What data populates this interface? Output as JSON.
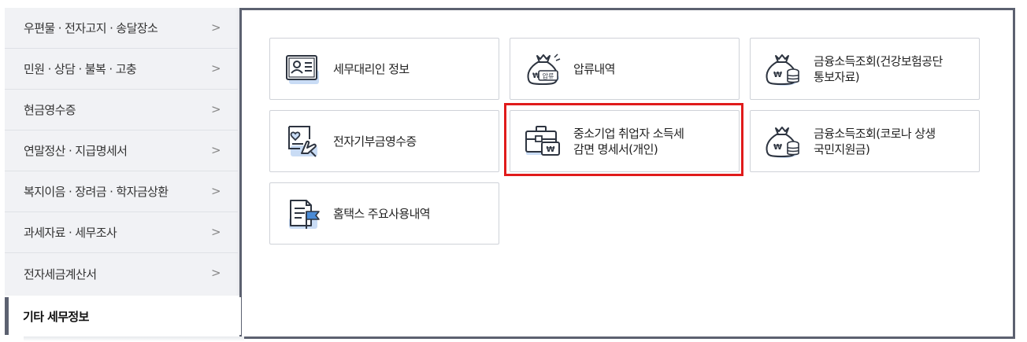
{
  "sidebar": {
    "items": [
      {
        "label": "우편물 · 전자고지 · 송달장소"
      },
      {
        "label": "민원 · 상담 · 불복 · 고충"
      },
      {
        "label": "현금영수증"
      },
      {
        "label": "연말정산 · 지급명세서"
      },
      {
        "label": "복지이음 · 장려금 · 학자금상환"
      },
      {
        "label": "과세자료 · 세무조사"
      },
      {
        "label": "전자세금계산서"
      }
    ],
    "active": {
      "label": "기타 세무정보"
    },
    "chevron": ">"
  },
  "cards": [
    {
      "label": "세무대리인 정보",
      "icon": "id-card-icon"
    },
    {
      "label": "압류내역",
      "icon": "money-bag-seizure-icon",
      "badge": "압류"
    },
    {
      "label": "금융소득조회(건강보험공단\n통보자료)",
      "icon": "money-bag-coins-icon"
    },
    {
      "label": "전자기부금영수증",
      "icon": "donation-receipt-icon"
    },
    {
      "label": "중소기업 취업자 소득세\n감면 명세서(개인)",
      "icon": "briefcase-won-icon"
    },
    {
      "label": "금융소득조회(코로나 상생\n국민지원금)",
      "icon": "money-bag-coins-icon"
    },
    {
      "label": "홈택스 주요사용내역",
      "icon": "document-flag-icon"
    }
  ],
  "colors": {
    "accent_blue": "#c9dcf5",
    "icon_stroke": "#2d3440",
    "highlight": "#e01b1b",
    "frame": "#5c6170"
  }
}
